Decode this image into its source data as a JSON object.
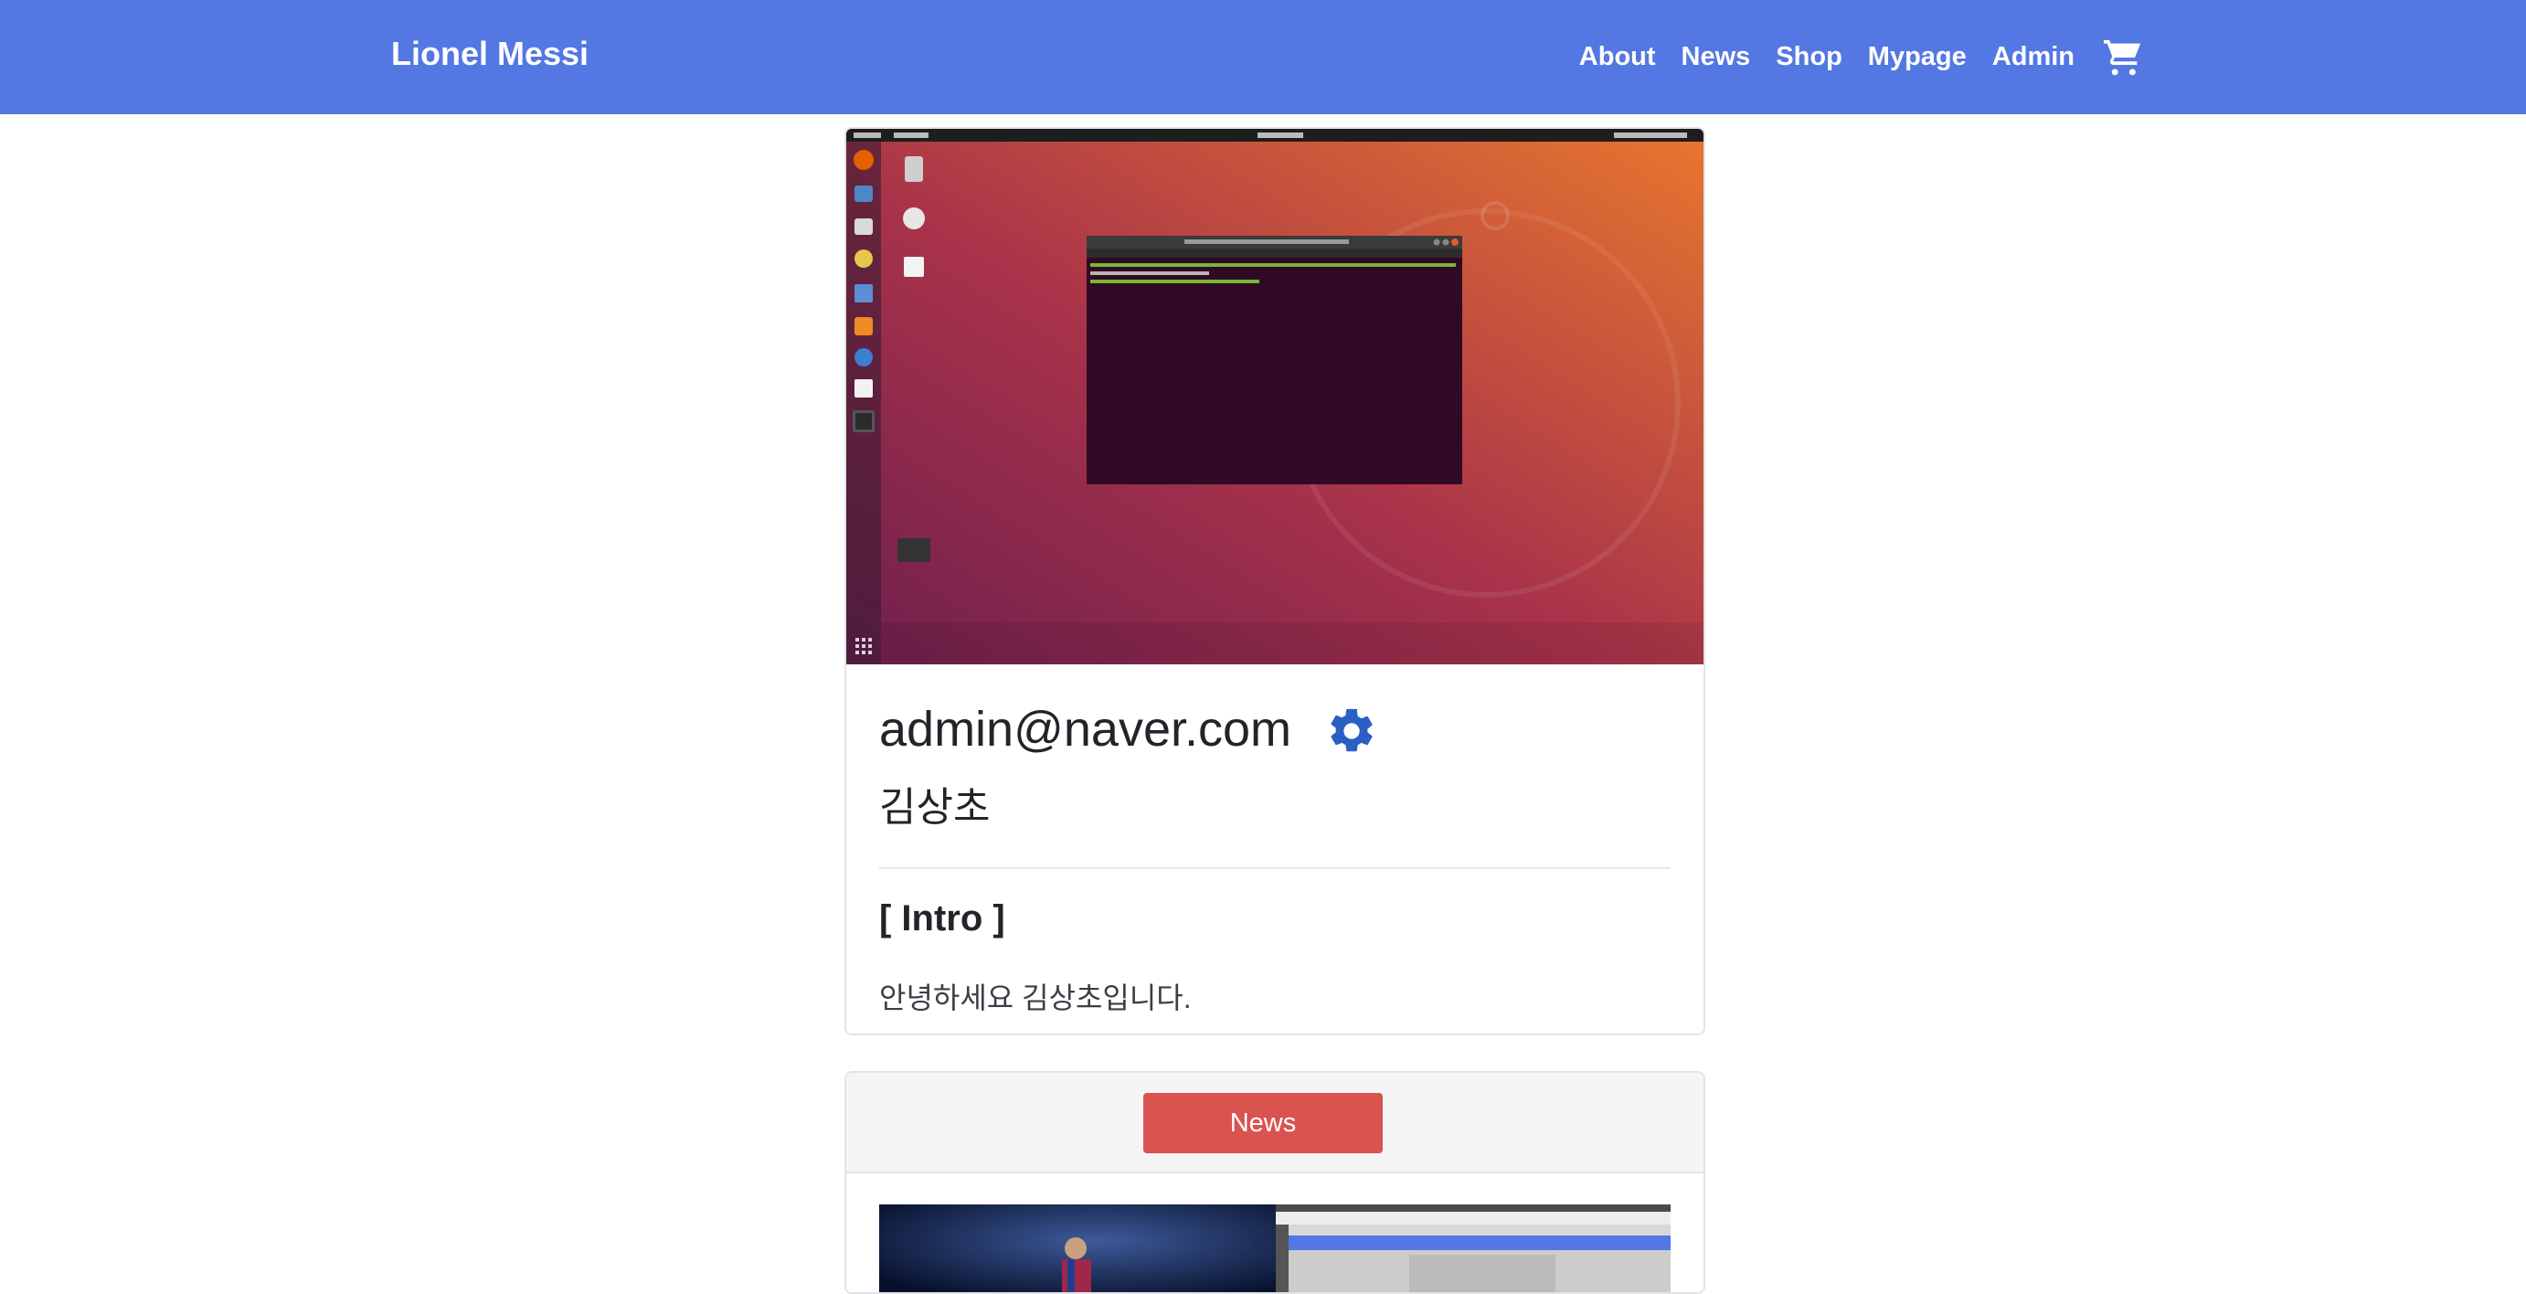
{
  "navbar": {
    "brand": "Lionel Messi",
    "links": [
      "About",
      "News",
      "Shop",
      "Mypage",
      "Admin"
    ],
    "cart_icon": "shopping-cart-icon"
  },
  "profile": {
    "image_desc": "ubuntu-desktop-screenshot",
    "email": "admin@naver.com",
    "settings_icon": "gear-icon",
    "name": "김상초",
    "intro_title": "[ Intro ]",
    "intro_text": "안녕하세요 김상초입니다."
  },
  "news_section": {
    "button_label": "News"
  },
  "colors": {
    "navbar": "#5377e3",
    "gear": "#2b5fc4",
    "news_button": "#d9534f"
  }
}
